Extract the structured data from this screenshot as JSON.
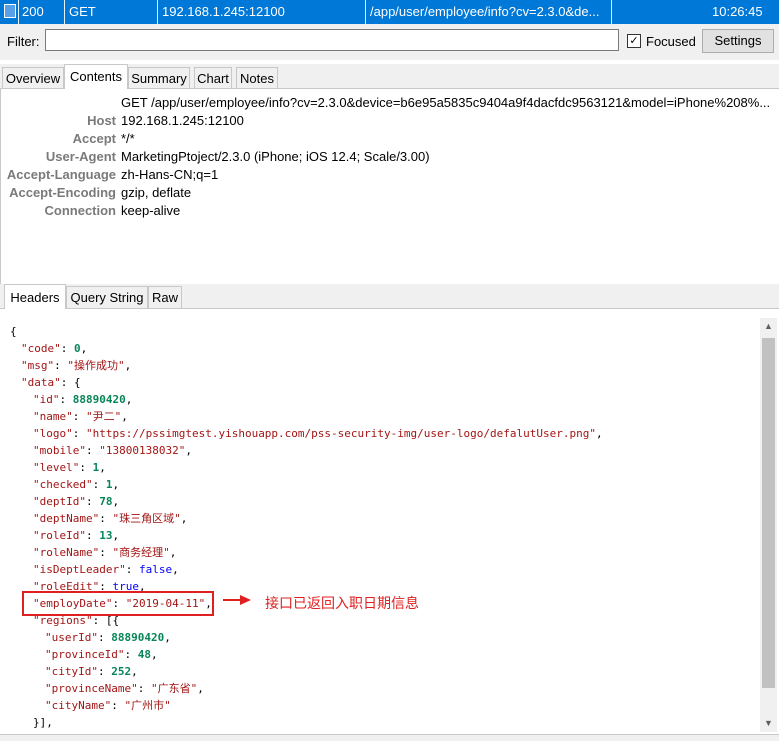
{
  "session_row": {
    "result": "200",
    "protocol": "GET",
    "host": "192.168.1.245:12100",
    "url": "/app/user/employee/info?cv=2.3.0&de...",
    "time": "10:26:45"
  },
  "filter": {
    "label": "Filter:",
    "value": "",
    "focused_label": "Focused",
    "focused_checked": "✓",
    "settings_label": "Settings"
  },
  "tabs": [
    "Overview",
    "Contents",
    "Summary",
    "Chart",
    "Notes"
  ],
  "request": {
    "first_line": "GET /app/user/employee/info?cv=2.3.0&device=b6e95a5835c9404a9f4dacfdc9563121&model=iPhone%208%...",
    "headers": [
      {
        "key": "Host",
        "value": "192.168.1.245:12100"
      },
      {
        "key": "Accept",
        "value": "*/*"
      },
      {
        "key": "User-Agent",
        "value": "MarketingPtoject/2.3.0 (iPhone; iOS 12.4; Scale/3.00)"
      },
      {
        "key": "Accept-Language",
        "value": "zh-Hans-CN;q=1"
      },
      {
        "key": "Accept-Encoding",
        "value": "gzip, deflate"
      },
      {
        "key": "Connection",
        "value": "keep-alive"
      }
    ]
  },
  "subtabs": [
    "Headers",
    "Query String",
    "Raw"
  ],
  "response_json": {
    "open_brace": "{",
    "code": "0",
    "msg": "操作成功",
    "data": {
      "id": "88890420",
      "name": "尹二",
      "logo": "https://pssimgtest.yishouapp.com/pss-security-img/user-logo/defalutUser.png",
      "mobile": "13800138032",
      "level": "1",
      "checked": "1",
      "deptId": "78",
      "deptName": "珠三角区域",
      "roleId": "13",
      "roleName": "商务经理",
      "isDeptLeader": "false",
      "roleEdit": "true",
      "employDate": "2019-04-11",
      "regions": {
        "userId": "88890420",
        "provinceId": "48",
        "cityId": "252",
        "provinceName": "广东省",
        "cityName": "广州市"
      }
    },
    "close_array": "}],"
  },
  "annotation": "接口已返回入职日期信息",
  "colors": {
    "selection_blue": "#0078d7",
    "annotation_red": "#e02020",
    "json_string": "#a31515",
    "json_number": "#098658",
    "json_bool": "#0000ff"
  }
}
